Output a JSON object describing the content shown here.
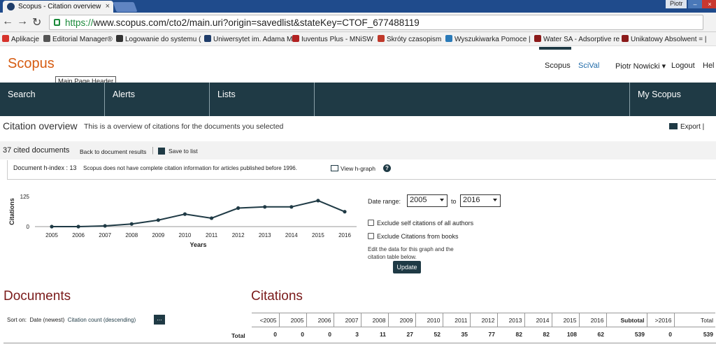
{
  "browser": {
    "tab_title": "Scopus - Citation overview",
    "user_label": "Piotr",
    "url_scheme": "https://",
    "url_rest": "www.scopus.com/cto2/main.uri?origin=savedlist&stateKey=CTOF_677488119",
    "bookmarks": [
      {
        "label": "Aplikacje",
        "color": "#d6332c"
      },
      {
        "label": "Editorial Manager®",
        "color": "#555555"
      },
      {
        "label": "Logowanie do systemu (",
        "color": "#333333"
      },
      {
        "label": "Uniwersytet im. Adama M",
        "color": "#1f3d6a"
      },
      {
        "label": "Iuventus Plus - MNiSW",
        "color": "#b22222"
      },
      {
        "label": "Skróty czasopism",
        "color": "#c0392b"
      },
      {
        "label": "Wyszukiwarka Pomoce |",
        "color": "#2a7ab8"
      },
      {
        "label": "Water SA - Adsorptive re",
        "color": "#8b1a1a"
      },
      {
        "label": "Unikatowy Absolwent = |",
        "color": "#8b1a1a"
      }
    ]
  },
  "header": {
    "logo": "Scopus",
    "tooltip": "Main Page Header",
    "links": {
      "scopus": "Scopus",
      "scival": "SciVal",
      "user": "Piotr Nowicki ▾",
      "logout": "Logout",
      "help": "Hel"
    },
    "nav": {
      "search": "Search",
      "alerts": "Alerts",
      "lists": "Lists",
      "myscopus": "My Scopus"
    }
  },
  "page": {
    "title": "Citation overview",
    "subtitle": "This is a overview of citations for the documents you selected",
    "export": "Export",
    "cited_count": "37 cited documents",
    "back_link": "Back to document results",
    "save_link": "Save to list",
    "hindex": "Document h-index : 13",
    "hwarning": "Scopus does not have complete citation information for articles published before 1996.",
    "hgraph": "View h-graph"
  },
  "controls": {
    "date_range_label": "Date range:",
    "from_year": "2005",
    "to_label": "to",
    "to_year": "2016",
    "exclude_self": "Exclude self citations of all authors",
    "exclude_books": "Exclude Citations from books",
    "note": "Edit the data for this graph and the citation table below.",
    "update": "Update"
  },
  "chart_data": {
    "type": "line",
    "x": [
      2005,
      2006,
      2007,
      2008,
      2009,
      2010,
      2011,
      2012,
      2013,
      2014,
      2015,
      2016
    ],
    "values": [
      0,
      0,
      3,
      11,
      27,
      52,
      35,
      77,
      82,
      82,
      108,
      62
    ],
    "xlabel": "Years",
    "ylabel": "Citations",
    "yticks": [
      "0",
      "125"
    ],
    "ylim": [
      0,
      125
    ],
    "color": "#1f3a45"
  },
  "documents": {
    "heading": "Documents",
    "sort_on": "Sort on:",
    "sort_date": "Date (newest)",
    "sort_citation": "Citation count (descending)",
    "more": "..."
  },
  "citations": {
    "heading": "Citations",
    "headers": [
      "<2005",
      "2005",
      "2006",
      "2007",
      "2008",
      "2009",
      "2010",
      "2011",
      "2012",
      "2013",
      "2014",
      "2015",
      "2016",
      "Subtotal",
      ">2016",
      "Total"
    ],
    "total_label": "Total",
    "totals": [
      "0",
      "0",
      "0",
      "3",
      "11",
      "27",
      "52",
      "35",
      "77",
      "82",
      "82",
      "108",
      "62",
      "539",
      "0",
      "539"
    ]
  }
}
